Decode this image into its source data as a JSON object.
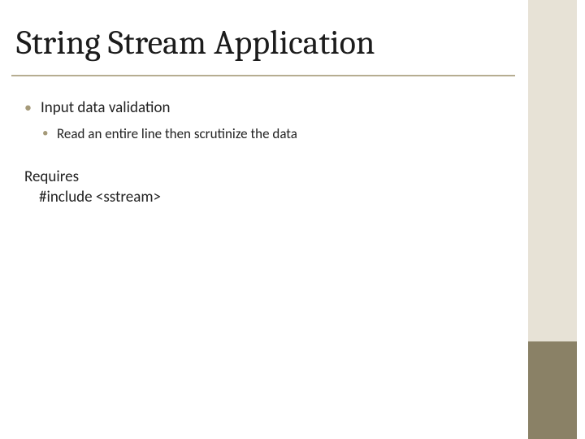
{
  "title": "String Stream Application",
  "bullets": {
    "lvl1": "Input data validation",
    "lvl2": "Read an entire line  then scrutinize  the data"
  },
  "requires": {
    "label": "Requires",
    "code": "#include <sstream>"
  }
}
